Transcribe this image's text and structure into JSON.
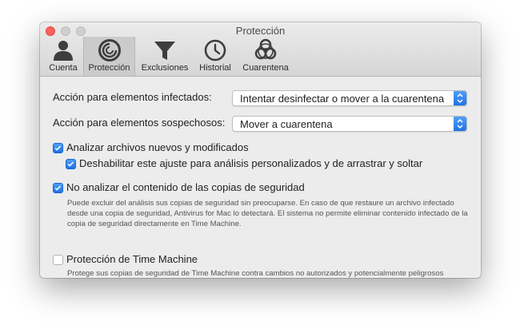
{
  "window": {
    "title": "Protección"
  },
  "tabs": [
    {
      "label": "Cuenta",
      "icon": "user-icon",
      "selected": false
    },
    {
      "label": "Protección",
      "icon": "shield-target-icon",
      "selected": true
    },
    {
      "label": "Exclusiones",
      "icon": "funnel-filter-icon",
      "selected": false
    },
    {
      "label": "Historial",
      "icon": "clock-icon",
      "selected": false
    },
    {
      "label": "Cuarentena",
      "icon": "biohazard-icon",
      "selected": false
    }
  ],
  "settings": {
    "infected": {
      "label": "Acción para elementos infectados:",
      "value": "Intentar desinfectar o mover a la cuarentena"
    },
    "suspicious": {
      "label": "Acción para elementos sospechosos:",
      "value": "Mover a cuarentena"
    },
    "scan_new": {
      "label": "Analizar archivos nuevos y modificados",
      "checked": true
    },
    "disable_custom": {
      "label": "Deshabilitar este ajuste para análisis personalizados y de arrastrar y soltar",
      "checked": true
    },
    "no_backups": {
      "label": "No analizar el contenido de las copias de seguridad",
      "checked": true,
      "description": "Puede excluir del análisis sus copias de seguridad sin preocuparse. En caso de que restaure un archivo infectado desde una copia de seguridad, Antivirus for Mac lo detectará. El sistema no permite eliminar contenido infectado de la copia de seguridad directamente en Time Machine."
    },
    "time_machine": {
      "label": "Protección de Time Machine",
      "checked": false,
      "description": "Protege sus copias de seguridad de Time Machine contra cambios no autorizados y potencialmente peligrosos realizados por otras aplicaciones."
    }
  },
  "colors": {
    "accent": "#2a7ff0",
    "close_button": "#fc605c",
    "window_bg": "#ececec"
  }
}
